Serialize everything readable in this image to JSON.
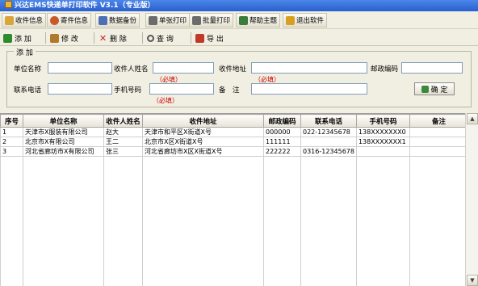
{
  "window": {
    "title": "兴达EMS快递单打印软件 V3.1（专业版）"
  },
  "toolbar_top": {
    "items": [
      {
        "label": "收件信息",
        "icon": "folder-user-icon",
        "color": "#d9a53a"
      },
      {
        "label": "寄件信息",
        "icon": "person-icon",
        "color": "#c85a2a"
      },
      {
        "label": "数据备份",
        "icon": "disk-icon",
        "color": "#4a6fb3"
      },
      {
        "label": "单张打印",
        "icon": "printer-icon",
        "color": "#6b6b6b"
      },
      {
        "label": "批量打印",
        "icon": "printer-stack-icon",
        "color": "#6b6b6b"
      },
      {
        "label": "帮助主题",
        "icon": "book-icon",
        "color": "#3a7d3a"
      },
      {
        "label": "退出软件",
        "icon": "exit-icon",
        "color": "#d8a020"
      }
    ]
  },
  "toolbar_actions": {
    "items": [
      {
        "label": "添 加",
        "icon": "add-icon",
        "color": "#2e8b2e"
      },
      {
        "label": "修 改",
        "icon": "edit-icon",
        "color": "#b07a2a"
      },
      {
        "label": "删 除",
        "icon": "delete-icon",
        "color": "#cc2222"
      },
      {
        "label": "查 询",
        "icon": "search-icon",
        "color": "#555555"
      },
      {
        "label": "导 出",
        "icon": "export-icon",
        "color": "#c0392b"
      }
    ]
  },
  "form": {
    "legend": "添 加",
    "labels": {
      "unit_name": "单位名称",
      "recipient_name": "收件人姓名",
      "address": "收件地址",
      "postcode": "邮政编码",
      "phone": "联系电话",
      "mobile": "手机号码",
      "remark": "备　注"
    },
    "required_hint": "（必填）",
    "values": {
      "unit_name": "",
      "recipient_name": "",
      "address": "",
      "postcode": "",
      "phone": "",
      "mobile": "",
      "remark": ""
    },
    "confirm_label": "确 定"
  },
  "grid": {
    "columns": [
      "序号",
      "单位名称",
      "收件人姓名",
      "收件地址",
      "邮政编码",
      "联系电话",
      "手机号码",
      "备注"
    ],
    "rows": [
      [
        "1",
        "天津市X服装有限公司",
        "赵大",
        "天津市和平区X街道X号",
        "000000",
        "022-12345678",
        "138XXXXXXX0",
        ""
      ],
      [
        "2",
        "北京市X有限公司",
        "王二",
        "北京市X区X街道X号",
        "111111",
        "",
        "138XXXXXXX1",
        ""
      ],
      [
        "3",
        "河北省廊坊市X有限公司",
        "张三",
        "河北省廊坊市X区X街道X号",
        "222222",
        "0316-12345678",
        "",
        ""
      ]
    ]
  },
  "colors": {
    "required": "#cc0000",
    "titlebar": "#2a5fcf",
    "window_bg": "#f1efe2"
  }
}
